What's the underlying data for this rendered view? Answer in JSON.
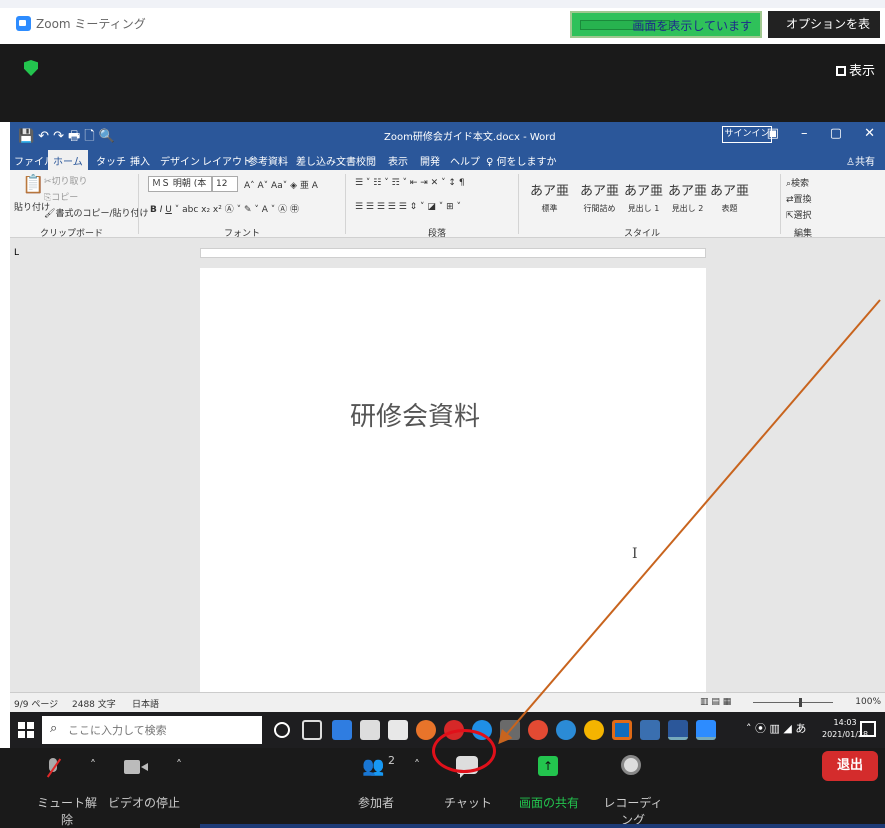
{
  "colors": {
    "zoom_blue": "#2d8cff",
    "word_blue": "#2b579a",
    "share_green": "#23c44e",
    "leave_red": "#d42c2c",
    "highlight_red": "#e0101a",
    "arrow": "#c8641e"
  },
  "zoom_window": {
    "title": "Zoom ミーティング",
    "share_banner": "画面を表示しています",
    "options_label": "オプションを表示",
    "view_label": "表示"
  },
  "word": {
    "title": "Zoom研修会ガイド本文.docx  -  Word",
    "signin_label": "サインイン",
    "tabs": [
      "ファイル",
      "ホーム",
      "タッチ",
      "挿入",
      "デザイン",
      "レイアウト",
      "参考資料",
      "差し込み文書",
      "校閲",
      "表示",
      "開発",
      "ヘルプ",
      "何をしますか"
    ],
    "share_label": "共有",
    "ribbon": {
      "paste_label": "貼り付け",
      "cut_label": "切り取り",
      "copy_label": "コピー",
      "format_painter_label": "書式のコピー/貼り付け",
      "clipboard_group": "クリップボード",
      "font_name": "ＭＳ 明朝 (本",
      "font_size": "12",
      "font_group": "フォント",
      "paragraph_group": "段落",
      "styles": [
        {
          "sample": "あア亜",
          "name": "標準"
        },
        {
          "sample": "あア亜",
          "name": "行間詰め"
        },
        {
          "sample": "あア亜",
          "name": "見出し 1"
        },
        {
          "sample": "あア亜",
          "name": "見出し 2"
        },
        {
          "sample": "あア亜",
          "name": "表題"
        }
      ],
      "style_group": "スタイル",
      "find_label": "検索",
      "replace_label": "置換",
      "select_label": "選択",
      "edit_group": "編集"
    },
    "document_heading": "研修会資料",
    "status": {
      "page": "9/9 ページ",
      "words": "2488 文字",
      "language": "日本語",
      "zoom": "100%"
    }
  },
  "taskbar": {
    "search_placeholder": "ここに入力して検索",
    "ime": "あ",
    "time": "14:03",
    "date": "2021/01/28"
  },
  "zoom_controls": {
    "mute_label": "ミュート解除",
    "video_label": "ビデオの停止",
    "participants_label": "参加者",
    "participants_count": "2",
    "chat_label": "チャット",
    "share_label": "画面の共有",
    "record_label": "レコーディング",
    "leave_label": "退出"
  }
}
